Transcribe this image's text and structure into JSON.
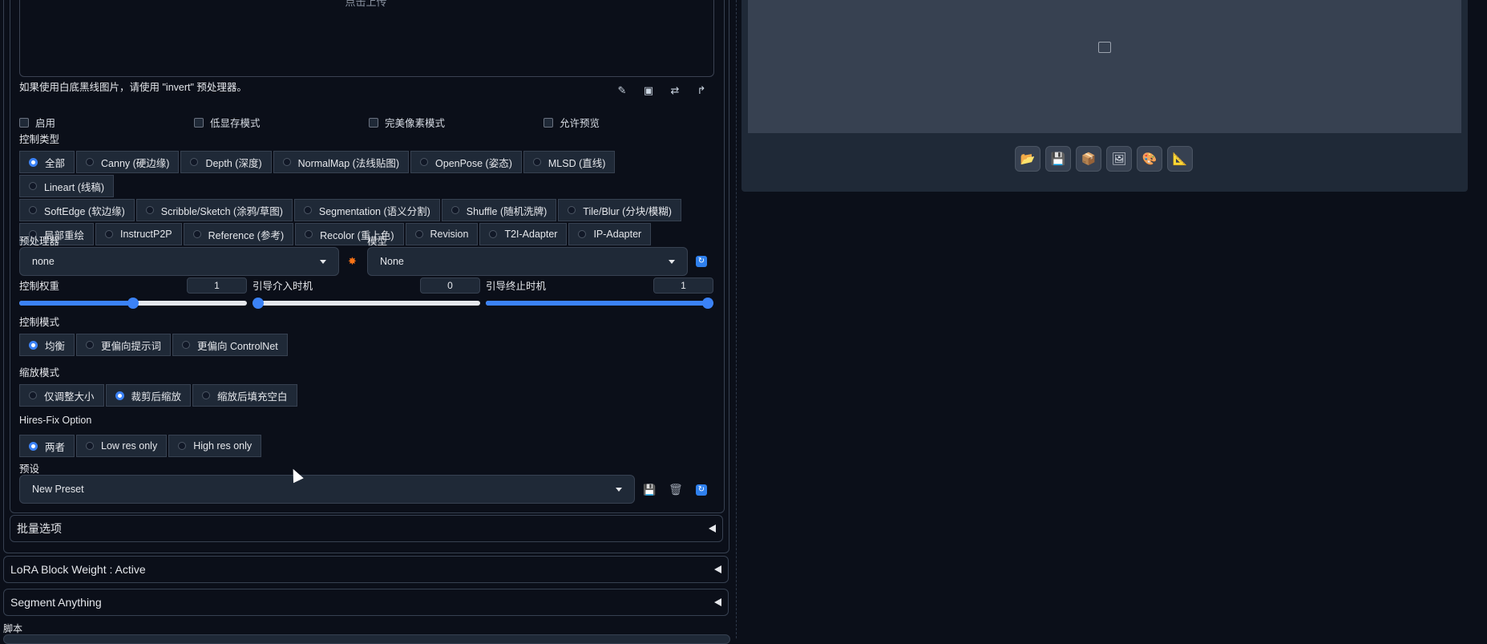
{
  "upload": {
    "text": "点击上传"
  },
  "note": "如果使用白底黑线图片，请使用 \"invert\" 预处理器。",
  "checkboxes": [
    {
      "label": "启用"
    },
    {
      "label": "低显存模式"
    },
    {
      "label": "完美像素模式"
    },
    {
      "label": "允许预览"
    }
  ],
  "control_type": {
    "label": "控制类型",
    "options": [
      {
        "label": "全部",
        "selected": true
      },
      {
        "label": "Canny (硬边缘)"
      },
      {
        "label": "Depth (深度)"
      },
      {
        "label": "NormalMap (法线贴图)"
      },
      {
        "label": "OpenPose (姿态)"
      },
      {
        "label": "MLSD (直线)"
      },
      {
        "label": "Lineart (线稿)"
      },
      {
        "label": "SoftEdge (软边缘)"
      },
      {
        "label": "Scribble/Sketch (涂鸦/草图)"
      },
      {
        "label": "Segmentation (语义分割)"
      },
      {
        "label": "Shuffle (随机洗牌)"
      },
      {
        "label": "Tile/Blur (分块/模糊)"
      },
      {
        "label": "局部重绘"
      },
      {
        "label": "InstructP2P"
      },
      {
        "label": "Reference (参考)"
      },
      {
        "label": "Recolor (重上色)"
      },
      {
        "label": "Revision"
      },
      {
        "label": "T2I-Adapter"
      },
      {
        "label": "IP-Adapter"
      }
    ]
  },
  "preprocessor": {
    "label": "预处理器",
    "value": "none"
  },
  "model": {
    "label": "模型",
    "value": "None"
  },
  "sliders": [
    {
      "label": "控制权重",
      "value": "1",
      "fraction": 0.5
    },
    {
      "label": "引导介入时机",
      "value": "0",
      "fraction": 0.0
    },
    {
      "label": "引导终止时机",
      "value": "1",
      "fraction": 1.0
    }
  ],
  "control_mode": {
    "label": "控制模式",
    "options": [
      {
        "label": "均衡",
        "selected": true
      },
      {
        "label": "更偏向提示词"
      },
      {
        "label": "更偏向 ControlNet"
      }
    ]
  },
  "resize_mode": {
    "label": "缩放模式",
    "options": [
      {
        "label": "仅调整大小"
      },
      {
        "label": "裁剪后缩放",
        "selected": true
      },
      {
        "label": "缩放后填充空白"
      }
    ]
  },
  "hires_fix": {
    "label": "Hires-Fix Option",
    "options": [
      {
        "label": "两者",
        "selected": true
      },
      {
        "label": "Low res only"
      },
      {
        "label": "High res only"
      }
    ]
  },
  "preset": {
    "label": "预设",
    "value": "New Preset"
  },
  "accordions": {
    "batch": "批量选项",
    "lora": "LoRA Block Weight : Active",
    "segment": "Segment Anything"
  },
  "script_label": "脚本",
  "colors": {
    "accent": "#3b82f6",
    "panel": "#1f2937",
    "background": "#0b0f19"
  },
  "right_toolbar_icons": [
    "folder-icon",
    "save-icon",
    "archive-icon",
    "image-icon",
    "palette-icon",
    "ruler-icon"
  ]
}
